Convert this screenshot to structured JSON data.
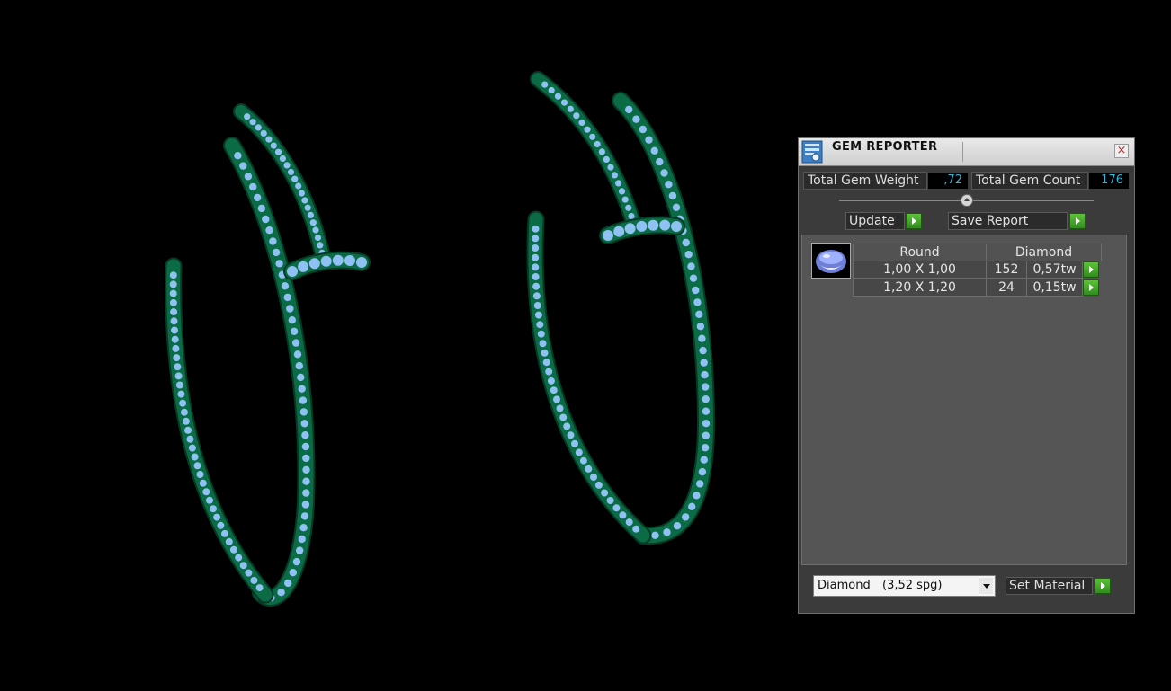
{
  "viewport": {
    "scene": "two-diamond-hoop-earrings",
    "background_color": "#000000",
    "metal_color": "#0b6b45",
    "gem_color": "#8fc2f2"
  },
  "panel": {
    "title": "GEM REPORTER",
    "close_glyph": "×",
    "total_weight_label": "Total Gem Weight",
    "total_weight_value": ",72",
    "total_count_label": "Total Gem Count",
    "total_count_value": "176",
    "update_label": "Update",
    "save_report_label": "Save Report",
    "table": {
      "shape_header": "Round",
      "material_header": "Diamond",
      "rows": [
        {
          "size": "1,00 X 1,00",
          "count": "152",
          "weight": "0,57tw"
        },
        {
          "size": "1,20 X 1,20",
          "count": "24",
          "weight": "0,15tw"
        }
      ]
    },
    "material_select": {
      "material": "Diamond",
      "density": "(3,52 spg)"
    },
    "set_material_label": "Set Material",
    "accent_color": "#2fb6d8",
    "go_button_color": "#3fa428"
  }
}
